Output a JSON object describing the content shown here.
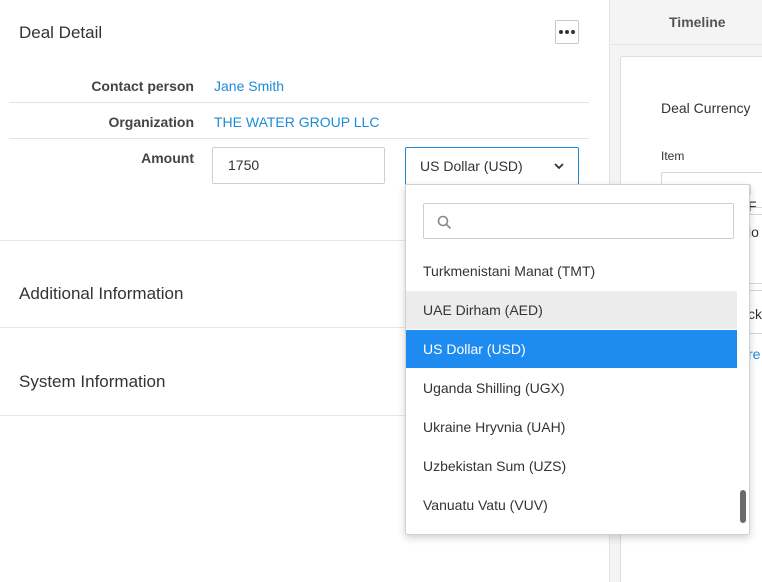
{
  "deal_detail": {
    "title": "Deal Detail",
    "fields": {
      "contact_label": "Contact person",
      "contact_value": "Jane Smith",
      "organization_label": "Organization",
      "organization_value": "THE WATER GROUP LLC",
      "amount_label": "Amount",
      "amount_value": "1750",
      "currency_value": "US Dollar (USD)"
    }
  },
  "sections": {
    "additional": "Additional Information",
    "system": "System Information"
  },
  "right_panel": {
    "tab": "Timeline",
    "deal_currency": "Deal Currency",
    "item_label": "Item",
    "input_frag": "l F",
    "box2_frag": "io",
    "box3_frag": "cka",
    "link_frag": "re"
  },
  "currency_dropdown": {
    "search_value": "",
    "options": [
      "Turkmenistani Manat (TMT)",
      "UAE Dirham (AED)",
      "US Dollar (USD)",
      "Uganda Shilling (UGX)",
      "Ukraine Hryvnia (UAH)",
      "Uzbekistan Sum (UZS)",
      "Vanuatu Vatu (VUV)"
    ],
    "hovered": "UAE Dirham (AED)",
    "selected": "US Dollar (USD)"
  },
  "colors": {
    "link": "#1e8bd6",
    "selected_bg": "#1e8bf0",
    "hover_bg": "#ececec"
  }
}
